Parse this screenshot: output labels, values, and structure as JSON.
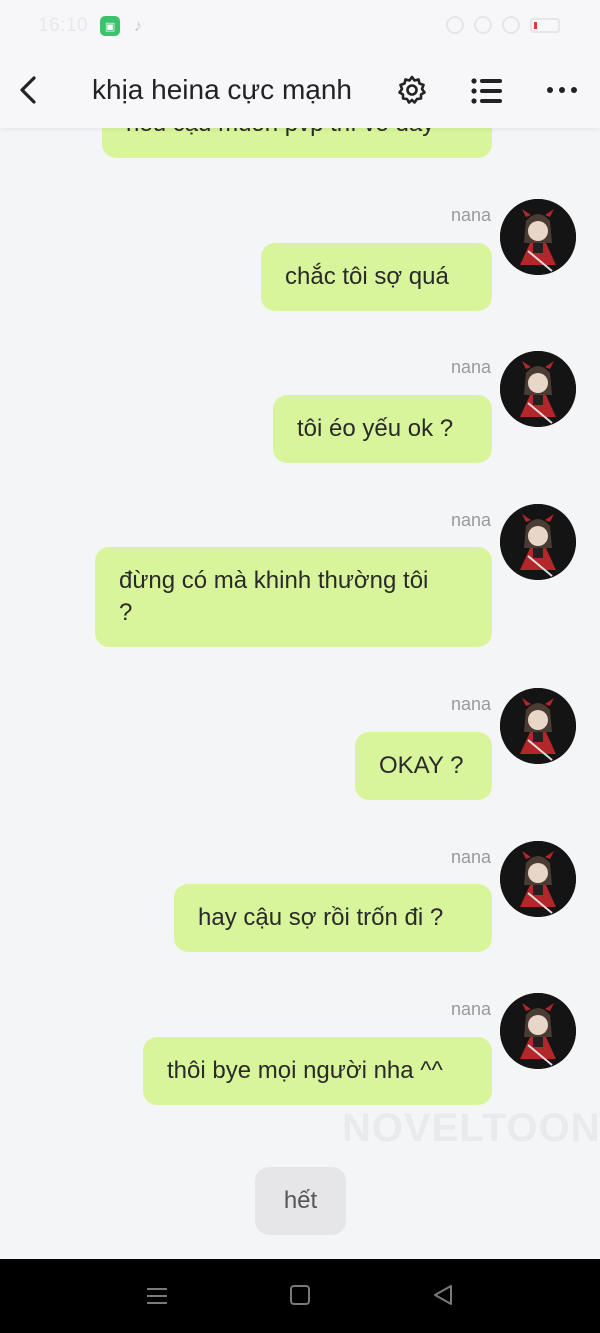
{
  "status_bar": {
    "time": "16:10"
  },
  "header": {
    "title": "khịa heina cực mạnh"
  },
  "messages": [
    {
      "text": "nếu cậu muốn pvp thì vô đây",
      "sender": ""
    },
    {
      "text": "chắc tôi sợ quá",
      "sender": "nana"
    },
    {
      "text": "tôi éo yếu ok ?",
      "sender": "nana"
    },
    {
      "text": "đừng có mà khinh thường tôi ?",
      "sender": "nana"
    },
    {
      "text": "OKAY ?",
      "sender": "nana"
    },
    {
      "text": "hay cậu sợ rồi trốn đi ?",
      "sender": "nana"
    },
    {
      "text": "thôi bye mọi người nha ^^",
      "sender": "nana"
    }
  ],
  "end_label": "hết",
  "watermark": "NOVELTOON",
  "colors": {
    "bubble": "#d9f59b",
    "background": "#f4f5f7",
    "avatar_accent": "#b3262a"
  }
}
